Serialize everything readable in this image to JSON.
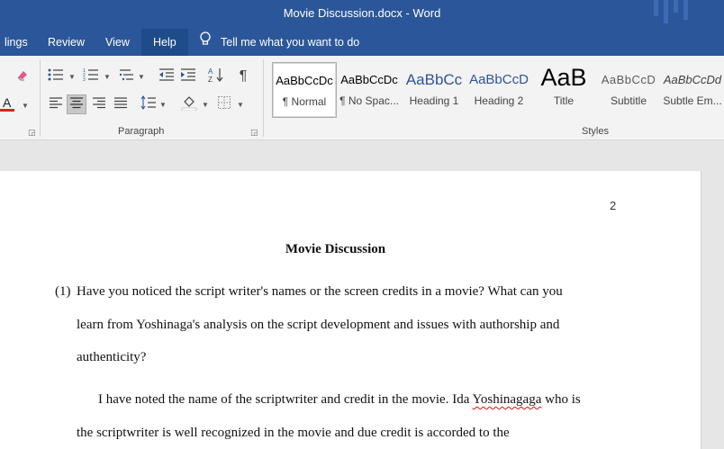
{
  "window": {
    "title": "Movie Discussion.docx  -  Word"
  },
  "menu": {
    "tabs": [
      {
        "label": "lings",
        "active": false
      },
      {
        "label": "Review",
        "active": false
      },
      {
        "label": "View",
        "active": false
      },
      {
        "label": "Help",
        "active": true
      }
    ],
    "tell_me": "Tell me what you want to do"
  },
  "ribbon": {
    "paragraph_label": "Paragraph",
    "styles_label": "Styles",
    "styles": [
      {
        "preview": "AaBbCcDc",
        "name": "¶ Normal",
        "selected": true
      },
      {
        "preview": "AaBbCcDc",
        "name": "¶ No Spac..."
      },
      {
        "preview": "AaBbCc",
        "name": "Heading 1"
      },
      {
        "preview": "AaBbCcD",
        "name": "Heading 2"
      },
      {
        "preview": "AaB",
        "name": "Title"
      },
      {
        "preview": "AaBbCcD",
        "name": "Subtitle"
      },
      {
        "preview": "AaBbCcDd",
        "name": "Subtle Em..."
      }
    ]
  },
  "document": {
    "page_number": "2",
    "title": "Movie Discussion",
    "question_marker": "(1)",
    "question_lines": [
      "Have you noticed the script writer's names or the screen credits in a movie? What can you",
      "learn from Yoshinaga's analysis on the script development and issues with authorship and",
      "authenticity?"
    ],
    "answer_line1_before": "I have noted the name of the scriptwriter and credit in the movie. Ida ",
    "answer_line1_misspelled": "Yoshinagaga",
    "answer_line1_after": " who is",
    "answer_line2": "the scriptwriter is well recognized in the movie and due credit is accorded to the"
  },
  "colors": {
    "title_bar": "#2b579a",
    "font_color_bar": "#e0201b",
    "spell_error": "#d11111"
  }
}
